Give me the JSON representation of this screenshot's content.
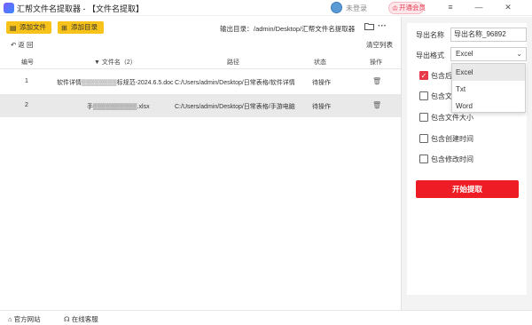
{
  "titlebar": {
    "title": "汇帮文件名提取器 - 【文件名提取】",
    "login": "未登录",
    "vip": "开通会员",
    "menu_icon": "≡",
    "minimize_icon": "—",
    "close_icon": "✕"
  },
  "toolbar": {
    "add_file": "添加文件",
    "add_dir": "添加目录",
    "output_label": "输出目录：",
    "output_path": "/admin/Desktop/汇帮文件名提取器",
    "more": "···"
  },
  "nav": {
    "back": "返  回",
    "clear": "清空列表"
  },
  "table": {
    "headers": [
      "编号",
      "文件名（2）",
      "路径",
      "状态",
      "操作"
    ],
    "sort_indicator": "▼",
    "rows": [
      {
        "id": "1",
        "name": "软件详情▒▒▒▒▒▒▒▒标规范-2024.6.5.doc",
        "path": "C:/Users/admin/Desktop/日常表格/软件详情",
        "status": "待操作"
      },
      {
        "id": "2",
        "name": "手▒▒▒▒▒▒▒▒▒▒.xlsx",
        "path": "C:/Users/admin/Desktop/日常表格/手游电脑",
        "status": "待操作"
      }
    ]
  },
  "settings": {
    "export_name_label": "导出名称",
    "export_name_value": "导出名称_96892",
    "export_format_label": "导出格式",
    "export_format_value": "Excel",
    "format_options": [
      "Excel",
      "Txt",
      "Word"
    ],
    "checkbox_label_prefix": "包含",
    "checkboxes": [
      {
        "label": "包含后缀",
        "checked": true
      },
      {
        "label": "包含文件夹",
        "checked": false
      },
      {
        "label": "包含文件大小",
        "checked": false
      },
      {
        "label": "包含创建时间",
        "checked": false
      },
      {
        "label": "包含修改时间",
        "checked": false
      }
    ],
    "start": "开始提取"
  },
  "footer": {
    "website": "官方网站",
    "service": "在线客服"
  },
  "colors": {
    "accent_yellow": "#f7c21a",
    "accent_red": "#ee1c24"
  }
}
